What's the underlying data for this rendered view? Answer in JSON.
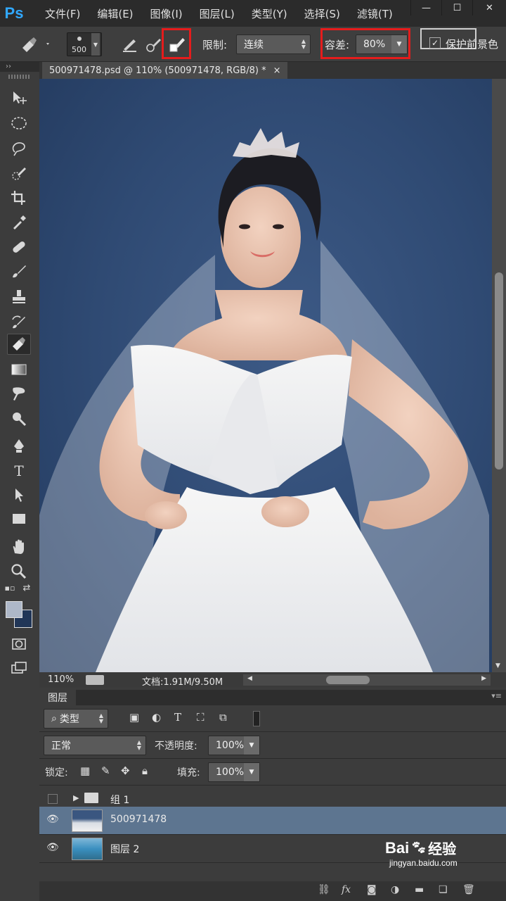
{
  "app": {
    "logo": "Ps"
  },
  "menu": [
    "文件(F)",
    "编辑(E)",
    "图像(I)",
    "图层(L)",
    "类型(Y)",
    "选择(S)",
    "滤镜(T)"
  ],
  "window_controls": {
    "minimize": "—",
    "maximize": "☐",
    "close": "✕"
  },
  "options": {
    "brush_size": "500",
    "limit_label": "限制:",
    "limit_value": "连续",
    "tolerance_label": "容差:",
    "tolerance_value": "80%",
    "protect_fg_checked": "✓",
    "protect_fg_label": "保护前景色",
    "highlight_color": "#e51c1c"
  },
  "document": {
    "tab_title": "500971478.psd @ 110% (500971478, RGB/8) *",
    "tab_close": "×",
    "zoom": "110%",
    "doc_info": "文档:1.91M/9.50M"
  },
  "colors": {
    "foreground": "#aeb8c8",
    "background": "#213657",
    "canvas_bg": "#2f4a73"
  },
  "layers_panel": {
    "title": "图层",
    "filter_label": "类型",
    "blend_mode": "正常",
    "opacity_label": "不透明度:",
    "opacity_value": "100%",
    "lock_label": "锁定:",
    "fill_label": "填充:",
    "fill_value": "100%",
    "layers": [
      {
        "name": "组 1",
        "type": "group",
        "visible": false
      },
      {
        "name": "500971478",
        "type": "pixel",
        "visible": true,
        "selected": true
      },
      {
        "name": "图层 2",
        "type": "pixel",
        "visible": true
      }
    ],
    "bottom_fx": "fx"
  },
  "watermark": {
    "brand": "Bai",
    "brand_cn": "经验",
    "url": "jingyan.baidu.com"
  }
}
